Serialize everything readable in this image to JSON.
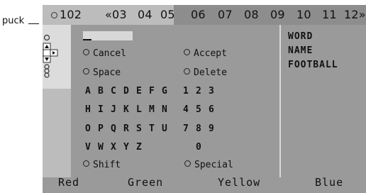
{
  "label_puck": "puck",
  "pages": {
    "current": "102",
    "items": [
      "«03",
      "04",
      "05",
      "06",
      "07",
      "08",
      "09",
      "10",
      "11",
      "12»"
    ]
  },
  "keyboard": {
    "input_value": "",
    "actions": {
      "cancel": "Cancel",
      "accept": "Accept",
      "space": "Space",
      "delete": "Delete",
      "shift": "Shift",
      "special": "Special"
    },
    "rows": [
      [
        "A",
        "B",
        "C",
        "D",
        "E",
        "F",
        "G",
        "1",
        "2",
        "3"
      ],
      [
        "H",
        "I",
        "J",
        "K",
        "L",
        "M",
        "N",
        "4",
        "5",
        "6"
      ],
      [
        "O",
        "P",
        "Q",
        "R",
        "S",
        "T",
        "U",
        "7",
        "8",
        "9"
      ],
      [
        "V",
        "W",
        "X",
        "Y",
        "Z",
        "0"
      ]
    ]
  },
  "suggestions": [
    "WORD",
    "NAME",
    "FOOTBALL"
  ],
  "color_keys": [
    "Red",
    "Green",
    "Yellow",
    "Blue"
  ]
}
